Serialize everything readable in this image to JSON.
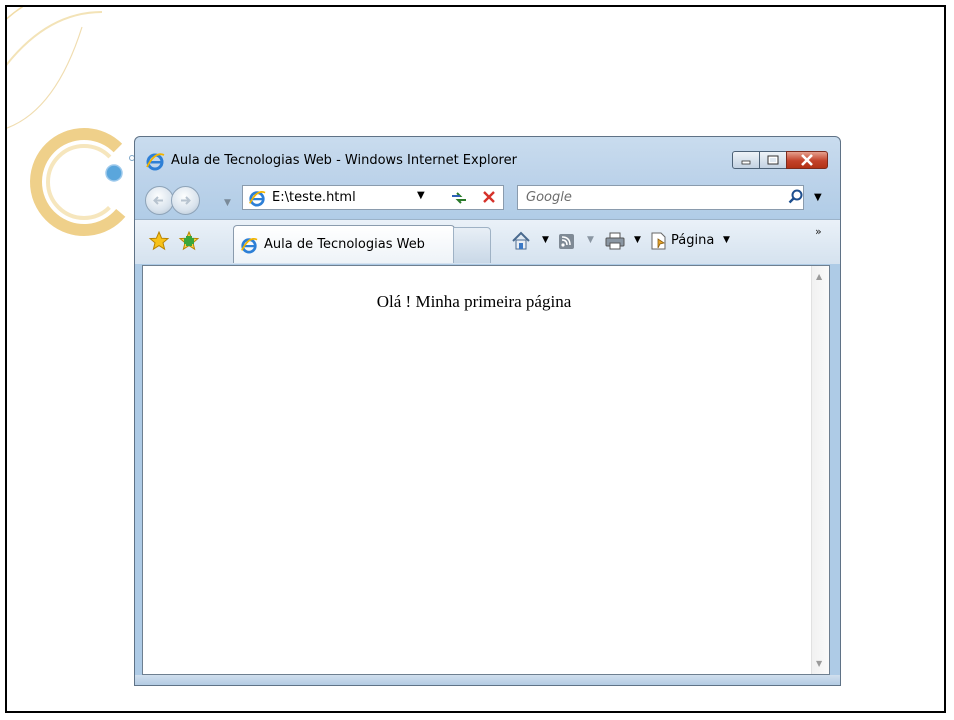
{
  "window": {
    "title": "Aula de Tecnologias Web - Windows Internet Explorer"
  },
  "toolbar": {
    "address": "E:\\teste.html",
    "search_placeholder": "Google"
  },
  "tabs": [
    {
      "label": "Aula de Tecnologias Web",
      "active": true
    }
  ],
  "command_bar": {
    "page_label": "Página",
    "overflow": "»"
  },
  "page": {
    "text": "Olá ! Minha primeira página"
  },
  "icons": {
    "ie": "ie-logo-icon",
    "favorites": "favorites-star-icon",
    "add_favorite": "add-favorite-icon",
    "home": "home-icon",
    "feeds": "rss-feed-icon",
    "print": "print-icon",
    "page": "page-icon",
    "search": "search-icon",
    "refresh": "refresh-icon",
    "stop": "stop-icon"
  },
  "colors": {
    "frame": "#aecbe6",
    "close_button": "#c3422a",
    "decor_gold": "#e9c36b"
  }
}
